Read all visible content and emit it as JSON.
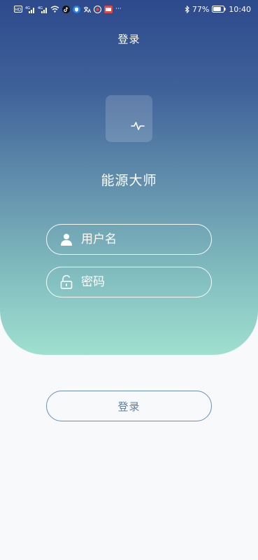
{
  "status_bar": {
    "left_icons": [
      "hd-icon",
      "4g-signal-icon",
      "4g-signal-icon",
      "wifi-icon",
      "tiktok-icon",
      "shield-icon",
      "translate-icon",
      "app-icon",
      "app-badge-icon"
    ],
    "more": "···",
    "bluetooth_icon": "bluetooth-icon",
    "battery_percent": "77%",
    "battery_level": 0.77,
    "time": "10:40"
  },
  "header": {
    "title": "登录"
  },
  "brand": {
    "logo_icon": "pulse-icon",
    "app_name": "能源大师"
  },
  "form": {
    "username": {
      "icon": "user-icon",
      "placeholder": "用户名",
      "value": ""
    },
    "password": {
      "icon": "lock-icon",
      "placeholder": "密码",
      "value": ""
    },
    "submit_label": "登录"
  },
  "colors": {
    "gradient_top": "#2d4a8c",
    "gradient_bottom": "#9fe0d0",
    "button_border": "#6a8fb5",
    "button_text": "#5b7fa6",
    "background": "#f8f9fa"
  }
}
